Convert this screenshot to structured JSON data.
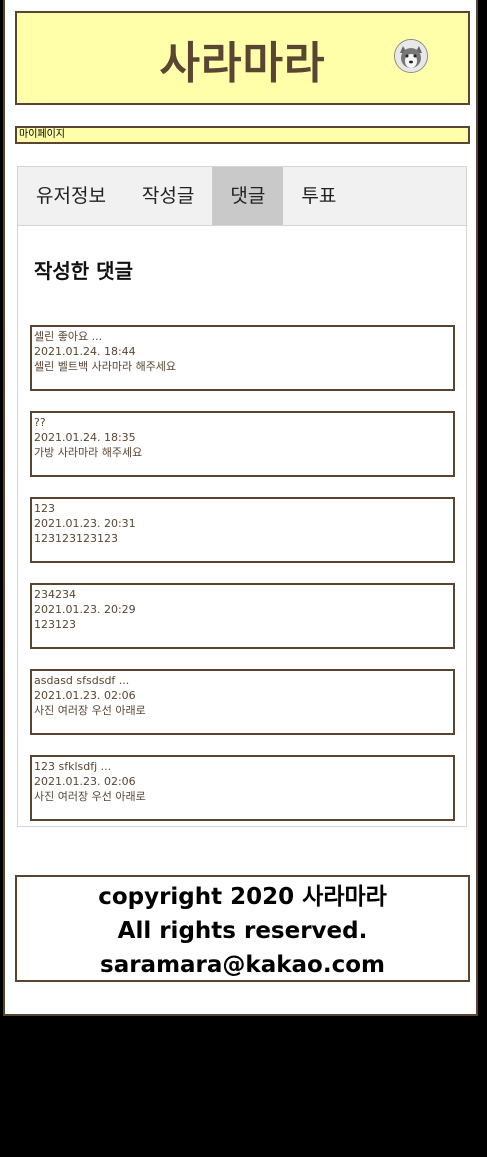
{
  "header": {
    "logo": "사라마라",
    "avatar_icon": "husky-avatar-icon"
  },
  "breadcrumb": "마이페이지",
  "tabs": [
    {
      "label": "유저정보",
      "active": false
    },
    {
      "label": "작성글",
      "active": false
    },
    {
      "label": "댓글",
      "active": true
    },
    {
      "label": "투표",
      "active": false
    }
  ],
  "section_title": "작성한 댓글",
  "comments": [
    {
      "post_title": "셀린 좋아요 ...",
      "date": "2021.01.24. 18:44",
      "text": "셀린 벨트백 사라마라 해주세요"
    },
    {
      "post_title": "??",
      "date": "2021.01.24. 18:35",
      "text": "가방 사라마라 해주세요"
    },
    {
      "post_title": "123",
      "date": "2021.01.23. 20:31",
      "text": "123123123123"
    },
    {
      "post_title": "234234",
      "date": "2021.01.23. 20:29",
      "text": "123123"
    },
    {
      "post_title": "asdasd sfsdsdf ...",
      "date": "2021.01.23. 02:06",
      "text": "사진 여러장 우선 아래로"
    },
    {
      "post_title": "123 sfklsdfj ...",
      "date": "2021.01.23. 02:06",
      "text": "사진 여러장 우선 아래로"
    }
  ],
  "footer": {
    "line1": "copyright 2020 사라마라",
    "line2": "All rights reserved.",
    "line3": "saramara@kakao.com"
  },
  "colors": {
    "accent_yellow": "#ffffaa",
    "brown": "#5a4532",
    "active_tab": "#c9c9c9"
  }
}
